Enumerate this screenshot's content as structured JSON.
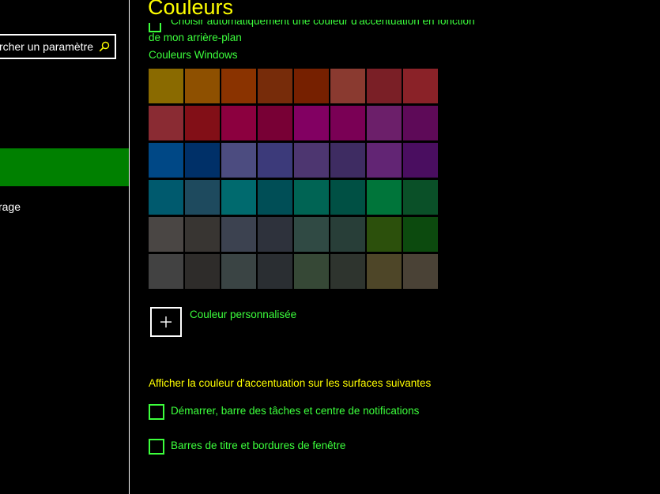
{
  "sidebar": {
    "search_value": "Rechercher un paramètre",
    "search_icon": "search-icon",
    "selected_item_label": "",
    "item_label": "Démarrage"
  },
  "header": {
    "title": "Couleurs"
  },
  "auto_accent": {
    "label_line1": "Choisir automatiquement une couleur d'accentuation en fonction",
    "label_line2": "de mon arrière-plan",
    "checked": false
  },
  "windows_colors": {
    "heading": "Couleurs Windows",
    "swatches": [
      [
        "#8a6a00",
        "#8e5000",
        "#8a3300",
        "#772c0a",
        "#762000",
        "#8a3a30",
        "#7a1f26",
        "#8a2228"
      ],
      [
        "#8a2b33",
        "#820f17",
        "#8c003f",
        "#780035",
        "#820062",
        "#7a0055",
        "#6c1f6a",
        "#5e0a58"
      ],
      [
        "#004886",
        "#003068",
        "#4c4c80",
        "#3c3a7a",
        "#4d3670",
        "#3e2c62",
        "#622574",
        "#4a0e60"
      ],
      [
        "#005a6e",
        "#1e4a5e",
        "#006a6e",
        "#004e56",
        "#006454",
        "#005044",
        "#00753a",
        "#0a5028"
      ],
      [
        "#4a4644",
        "#383532",
        "#3c4250",
        "#2e323c",
        "#304a44",
        "#283e38",
        "#2c500c",
        "#0c4a0e"
      ],
      [
        "#424242",
        "#2e2c2a",
        "#3a4444",
        "#2a2e32",
        "#364836",
        "#2e342e",
        "#4e4628",
        "#4a4236"
      ]
    ]
  },
  "custom_color": {
    "label": "Couleur personnalisée",
    "icon": "plus-icon"
  },
  "surfaces": {
    "heading": "Afficher la couleur d'accentuation sur les surfaces suivantes",
    "options": [
      {
        "label": "Démarrer, barre des tâches et centre de notifications",
        "checked": false
      },
      {
        "label": "Barres de titre et bordures de fenêtre",
        "checked": false
      }
    ]
  },
  "colors": {
    "background": "#000000",
    "title_yellow": "#ffff00",
    "accent_green": "#3cff3c",
    "nav_selected": "#008000",
    "border_white": "#ffffff"
  }
}
